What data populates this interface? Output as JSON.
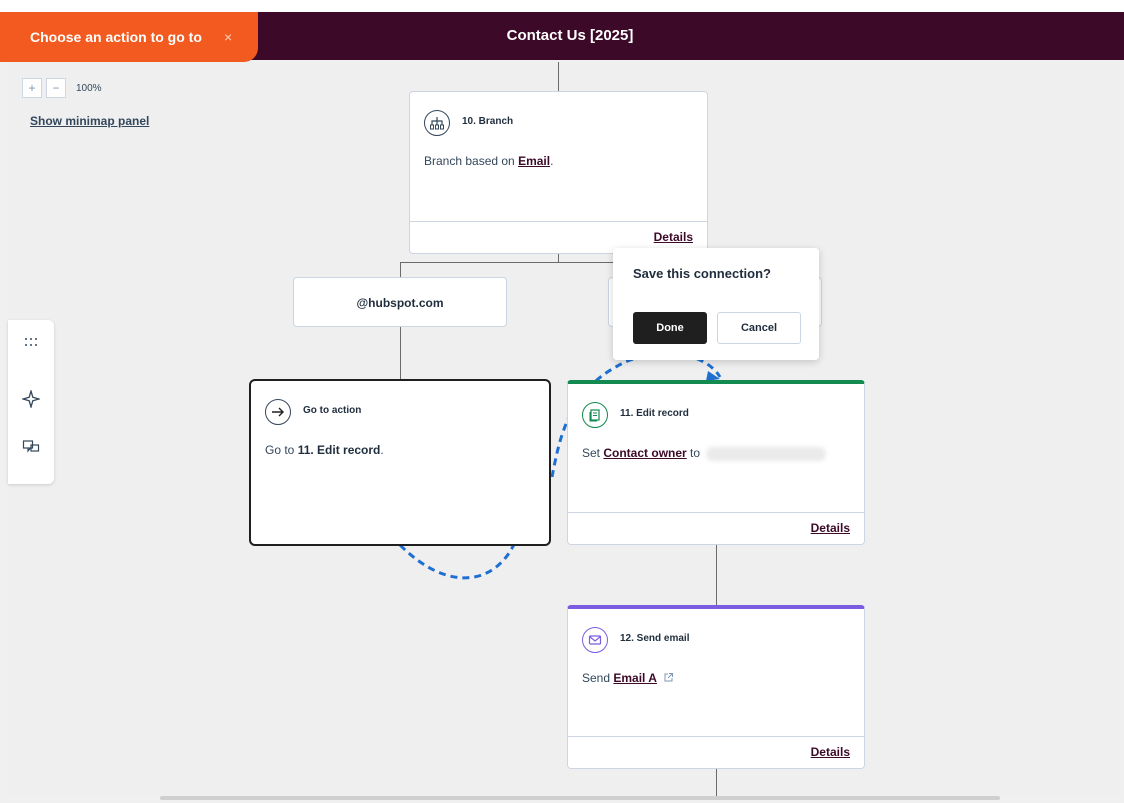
{
  "header": {
    "title": "Contact Us [2025]",
    "mode_label": "Choose an action to go to",
    "close_glyph": "×"
  },
  "zoom": {
    "plus": "+",
    "minus": "−",
    "level": "100%"
  },
  "minimap_link": "Show minimap panel",
  "side_tools": [
    "grid-icon",
    "sparkle-icon",
    "comments-icon"
  ],
  "branch_card": {
    "title": "10. Branch",
    "desc_prefix": "Branch based on ",
    "desc_link": "Email",
    "desc_suffix": ".",
    "details": "Details"
  },
  "branch_option": {
    "label": "@hubspot.com"
  },
  "goto_card": {
    "title": "Go to action",
    "desc_prefix": "Go to ",
    "desc_bold": "11. Edit record",
    "desc_suffix": "."
  },
  "edit_card": {
    "title": "11. Edit record",
    "desc_prefix": "Set ",
    "desc_link": "Contact owner",
    "desc_mid": " to",
    "details": "Details",
    "accent": "#138a4f"
  },
  "email_card": {
    "title": "12. Send email",
    "desc_prefix": "Send ",
    "desc_link": "Email A",
    "details": "Details",
    "accent": "#7c5ce0"
  },
  "popover": {
    "question": "Save this connection?",
    "done": "Done",
    "cancel": "Cancel"
  },
  "colors": {
    "brand_orange": "#f35a1f",
    "header_bg": "#3c0a28",
    "connector_blue": "#1f6fd1"
  }
}
